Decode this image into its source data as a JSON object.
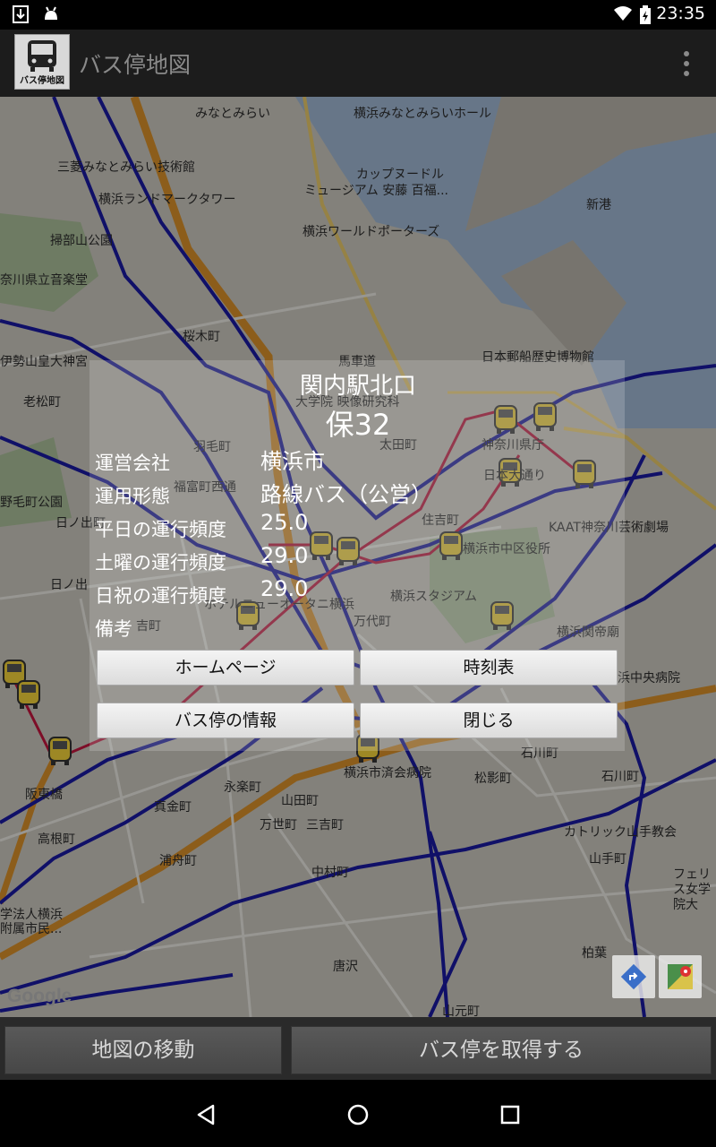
{
  "status_bar": {
    "time": "23:35"
  },
  "app_bar": {
    "title": "バス停地図",
    "icon_caption": "バス停地図"
  },
  "map_labels": [
    "みなとみらい",
    "横浜みなとみらいホール",
    "三菱みなとみらい技術館",
    "カップヌードル",
    "ミュージアム 安藤 百福...",
    "横浜ランドマークタワー",
    "新港",
    "横浜ワールドポーターズ",
    "掃部山公園",
    "奈川県立音楽堂",
    "桜木町",
    "馬車道",
    "日本郵船歴史博物館",
    "伊勢山皇大神宮",
    "老松町",
    "大学院 映像研究科",
    "太田町",
    "神奈川県庁",
    "羽毛町",
    "日本大通り",
    "福富町西通",
    "野毛町公園",
    "日ノ出町",
    "住吉町",
    "KAAT神奈川芸術劇場",
    "横浜市中区役所",
    "日ノ出",
    "横浜スタジアム",
    "万代町",
    "横浜関帝廟",
    "吉町",
    "浜中央病院",
    "石川町",
    "横浜市済会病院",
    "阪東橋",
    "松影町",
    "石川町",
    "永楽町",
    "山田町",
    "真金町",
    "三吉町",
    "万世町",
    "カトリック山手教会",
    "高根町",
    "浦舟町",
    "中村町",
    "山手町",
    "フェリス女学院大",
    "学法人横浜",
    "附属市民...",
    "柏葉",
    "唐沢",
    "山元町",
    "ホテルニューオータニ横浜"
  ],
  "dialog": {
    "stop_name": "関内駅北口",
    "route": "保32",
    "rows": [
      {
        "label": "運営会社",
        "value": "横浜市"
      },
      {
        "label": "運用形態",
        "value": "路線バス（公営）"
      },
      {
        "label": "平日の運行頻度",
        "value": "25.0"
      },
      {
        "label": "土曜の運行頻度",
        "value": "29.0"
      },
      {
        "label": "日祝の運行頻度",
        "value": "29.0"
      },
      {
        "label": "備考",
        "value": ""
      }
    ],
    "buttons": {
      "home": "ホームページ",
      "timetable": "時刻表",
      "stop_info": "バス停の情報",
      "close": "閉じる"
    }
  },
  "bottom": {
    "move_map": "地図の移動",
    "get_stops": "バス停を取得する"
  },
  "map_attribution": "Google",
  "colors": {
    "route_line": "#1a1aa0",
    "route_highlight": "#c0143c",
    "bus_icon": "#f2d23a"
  }
}
